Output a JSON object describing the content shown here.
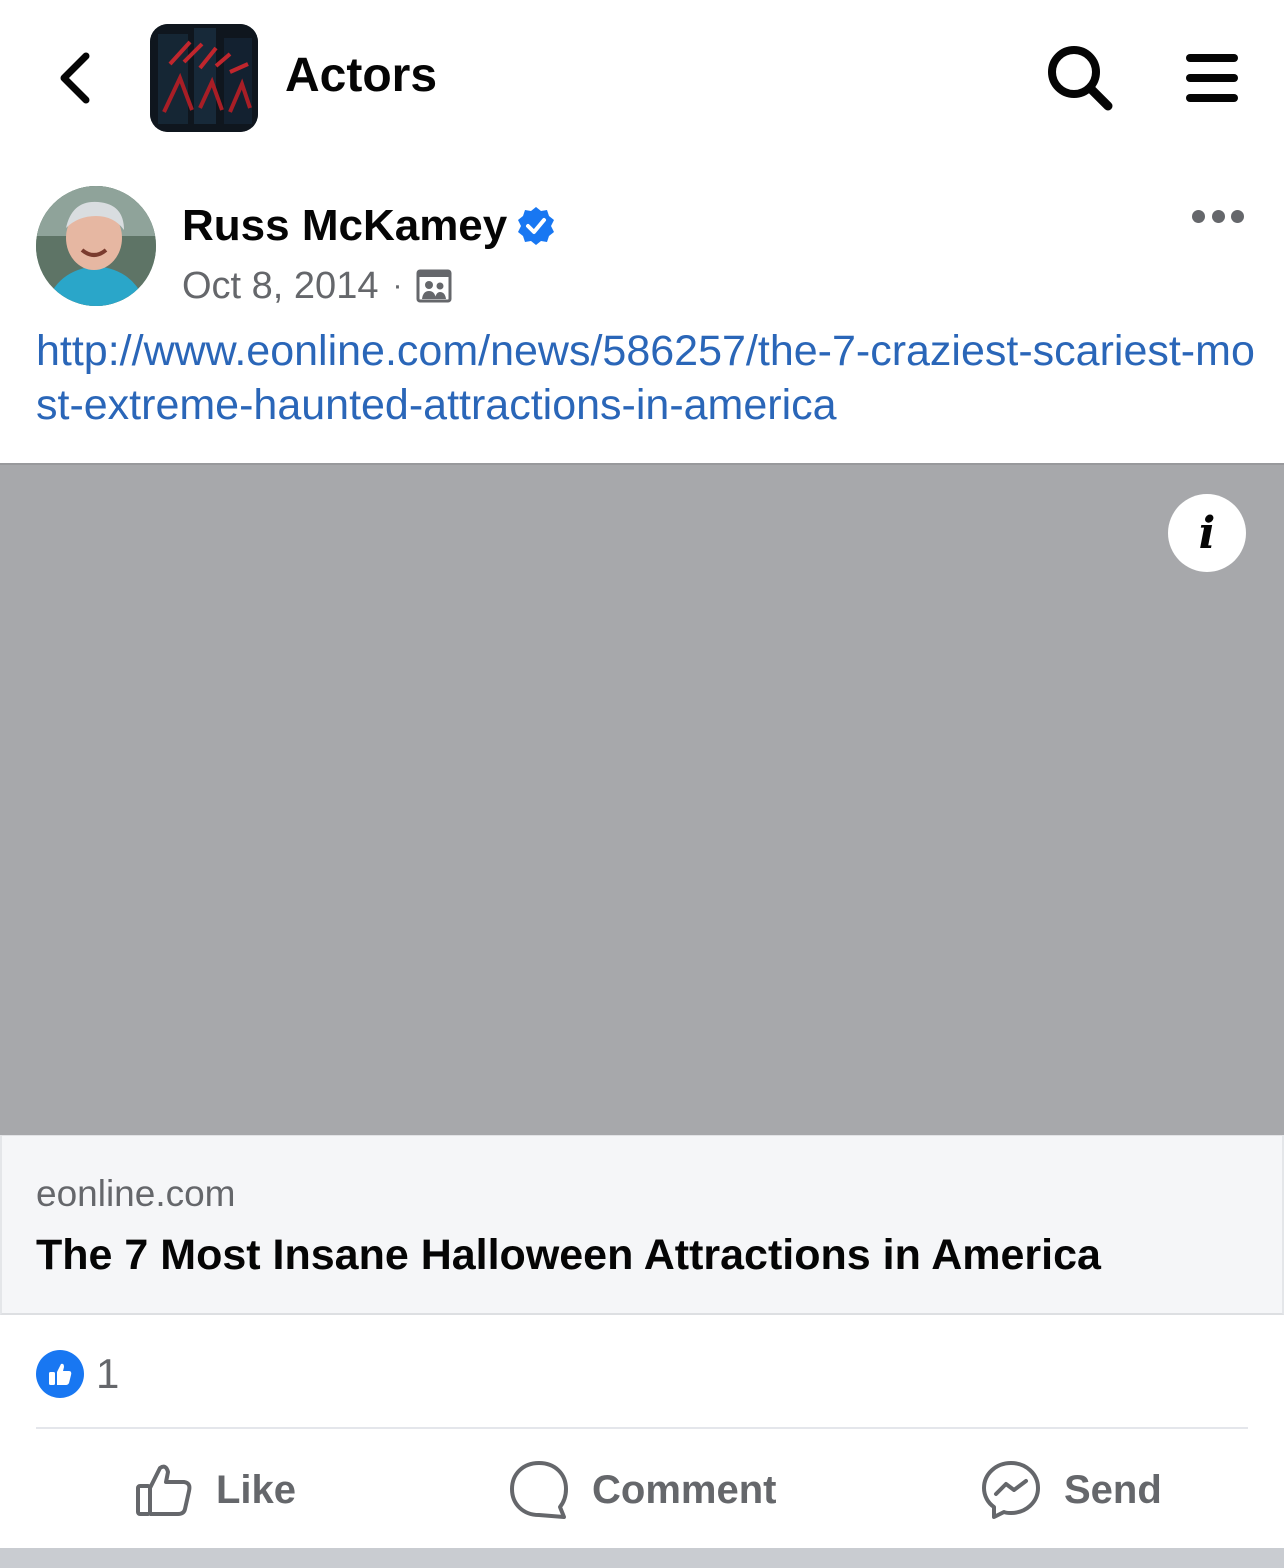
{
  "header": {
    "group_title": "Actors",
    "back_icon": "chevron-left-icon",
    "search_icon": "search-icon",
    "menu_icon": "hamburger-menu-icon"
  },
  "post": {
    "author": "Russ McKamey",
    "verified": true,
    "date": "Oct 8, 2014",
    "separator": "·",
    "audience_icon": "group-audience-icon",
    "link_text": "http://www.eonline.com/news/586257/the-7-craziest-scariest-most-extreme-haunted-attractions-in-america"
  },
  "link_preview": {
    "domain": "eonline.com",
    "title": "The 7 Most Insane Halloween Attractions in America",
    "info_label": "i"
  },
  "reactions": {
    "like_count": "1"
  },
  "actions": {
    "like": "Like",
    "comment": "Comment",
    "send": "Send"
  },
  "colors": {
    "link": "#2a66b8",
    "facebook_blue": "#1877f2",
    "secondary_text": "#65676b",
    "preview_image_bg": "#a7a8ab"
  }
}
